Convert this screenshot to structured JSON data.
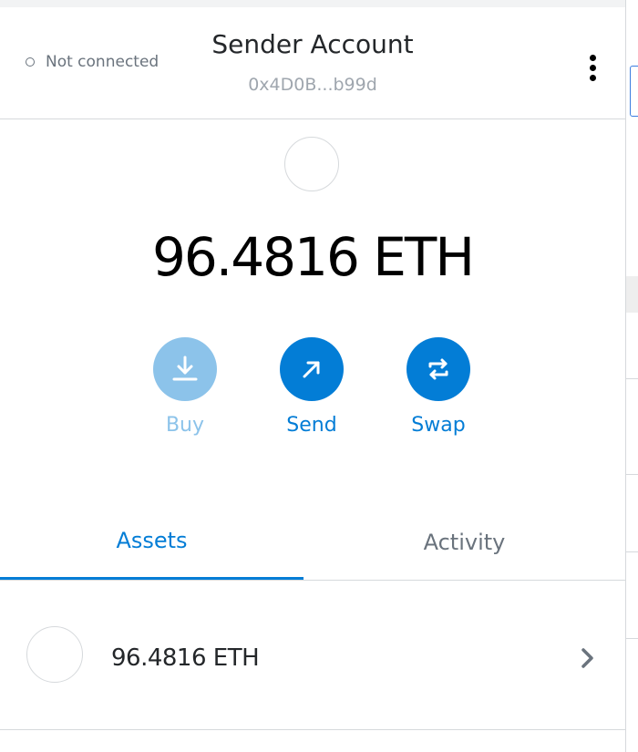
{
  "header": {
    "connection_status": "Not connected",
    "account_name": "Sender Account",
    "account_address": "0x4D0B...b99d",
    "menu_icon": "kebab-menu-icon"
  },
  "balance": {
    "amount": "96.4816 ETH"
  },
  "actions": [
    {
      "label": "Buy",
      "icon": "download-icon",
      "enabled": false
    },
    {
      "label": "Send",
      "icon": "arrow-up-right-icon",
      "enabled": true
    },
    {
      "label": "Swap",
      "icon": "swap-arrows-icon",
      "enabled": true
    }
  ],
  "tabs": [
    {
      "label": "Assets",
      "active": true
    },
    {
      "label": "Activity",
      "active": false
    }
  ],
  "assets": [
    {
      "label": "96.4816 ETH"
    }
  ],
  "colors": {
    "accent": "#037dd6",
    "accent_disabled": "#8cc3ea",
    "text": "#24272a",
    "muted": "#6a737d",
    "border": "#d6d9dc"
  }
}
